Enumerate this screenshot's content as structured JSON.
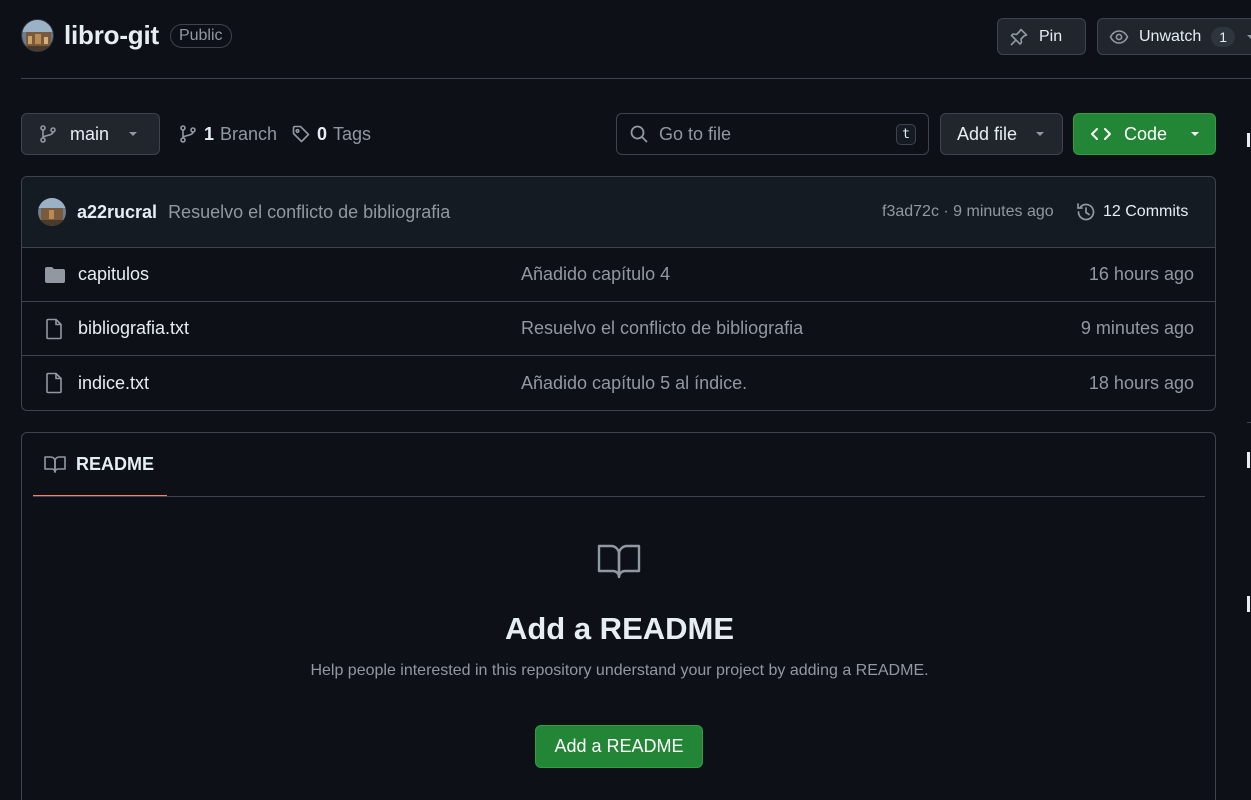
{
  "repo": {
    "name": "libro-git",
    "visibility": "Public"
  },
  "header_actions": {
    "pin_label": "Pin",
    "unwatch_label": "Unwatch",
    "watch_count": "1"
  },
  "toolbar": {
    "branch": "main",
    "branch_count": "1",
    "branch_label": "Branch",
    "tag_count": "0",
    "tag_label": "Tags",
    "search_placeholder": "Go to file",
    "search_shortcut": "t",
    "add_file_label": "Add file",
    "code_label": "Code"
  },
  "latest_commit": {
    "author": "a22rucral",
    "message": "Resuelvo el conflicto de bibliografia",
    "meta": "f3ad72c · 9 minutes ago",
    "commits_label": "12 Commits"
  },
  "files": [
    {
      "type": "folder",
      "name": "capitulos",
      "commit": "Añadido capítulo 4",
      "time": "16 hours ago"
    },
    {
      "type": "file",
      "name": "bibliografia.txt",
      "commit": "Resuelvo el conflicto de bibliografia",
      "time": "9 minutes ago"
    },
    {
      "type": "file",
      "name": "indice.txt",
      "commit": "Añadido capítulo 5 al índice.",
      "time": "18 hours ago"
    }
  ],
  "readme": {
    "tab_label": "README",
    "title": "Add a README",
    "help": "Help people interested in this repository understand your project by adding a README.",
    "button_label": "Add a README"
  },
  "colors": {
    "background": "#0d1117",
    "border": "#3d444d",
    "primary_green": "#238636",
    "muted_text": "#9198a1",
    "tab_underline": "#f78166"
  }
}
